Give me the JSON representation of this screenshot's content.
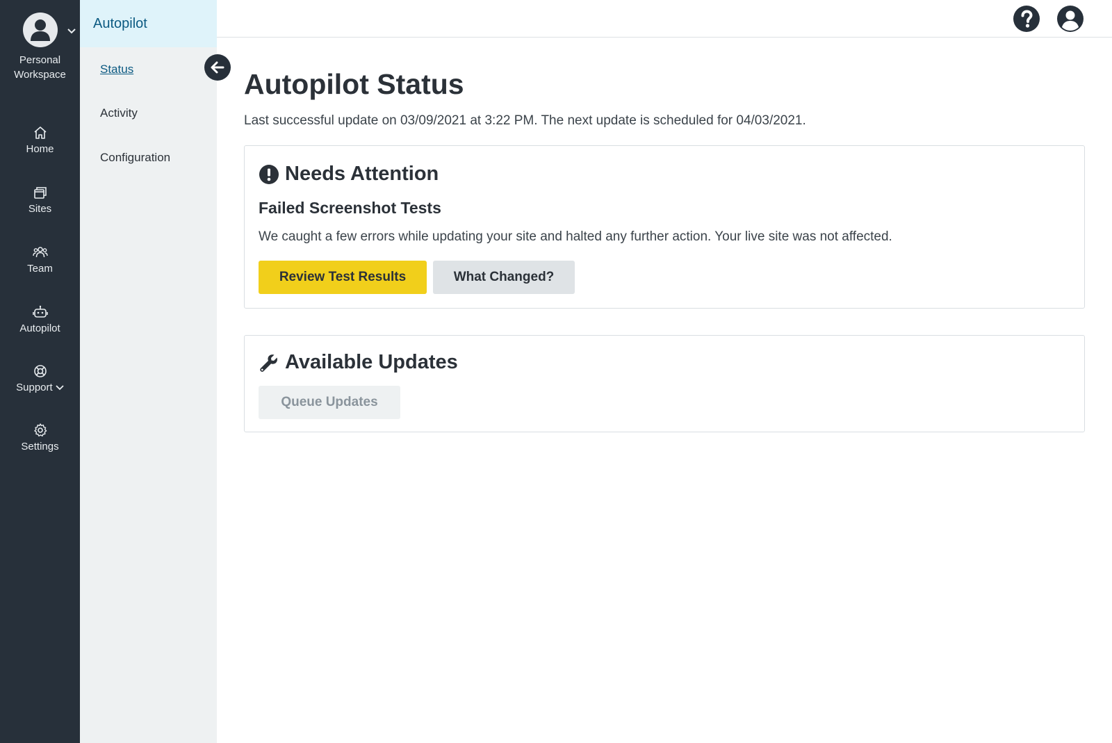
{
  "workspace": {
    "label_line1": "Personal",
    "label_line2": "Workspace"
  },
  "rail": {
    "items": [
      {
        "label": "Home",
        "icon": "home-icon"
      },
      {
        "label": "Sites",
        "icon": "sites-icon"
      },
      {
        "label": "Team",
        "icon": "team-icon"
      },
      {
        "label": "Autopilot",
        "icon": "robot-icon"
      },
      {
        "label": "Support",
        "icon": "lifebuoy-icon"
      },
      {
        "label": "Settings",
        "icon": "gear-icon"
      }
    ]
  },
  "subnav": {
    "header": "Autopilot",
    "items": [
      {
        "label": "Status",
        "active": true
      },
      {
        "label": "Activity"
      },
      {
        "label": "Configuration"
      }
    ]
  },
  "page": {
    "title": "Autopilot Status",
    "subtitle": "Last successful update on 03/09/2021 at 3:22 PM. The next update is scheduled for 04/03/2021."
  },
  "attention": {
    "title": "Needs Attention",
    "subtitle": "Failed Screenshot Tests",
    "text": "We caught a few errors while updating your site and halted any further action. Your live site was not affected.",
    "primary_button": "Review Test Results",
    "secondary_button": "What Changed?"
  },
  "updates": {
    "title": "Available Updates",
    "button": "Queue Updates"
  },
  "colors": {
    "rail_bg": "#27303a",
    "subnav_bg": "#eef1f2",
    "subnav_active_bg": "#dff3fa",
    "primary_button": "#f1cf1b",
    "link": "#0c5a82"
  }
}
